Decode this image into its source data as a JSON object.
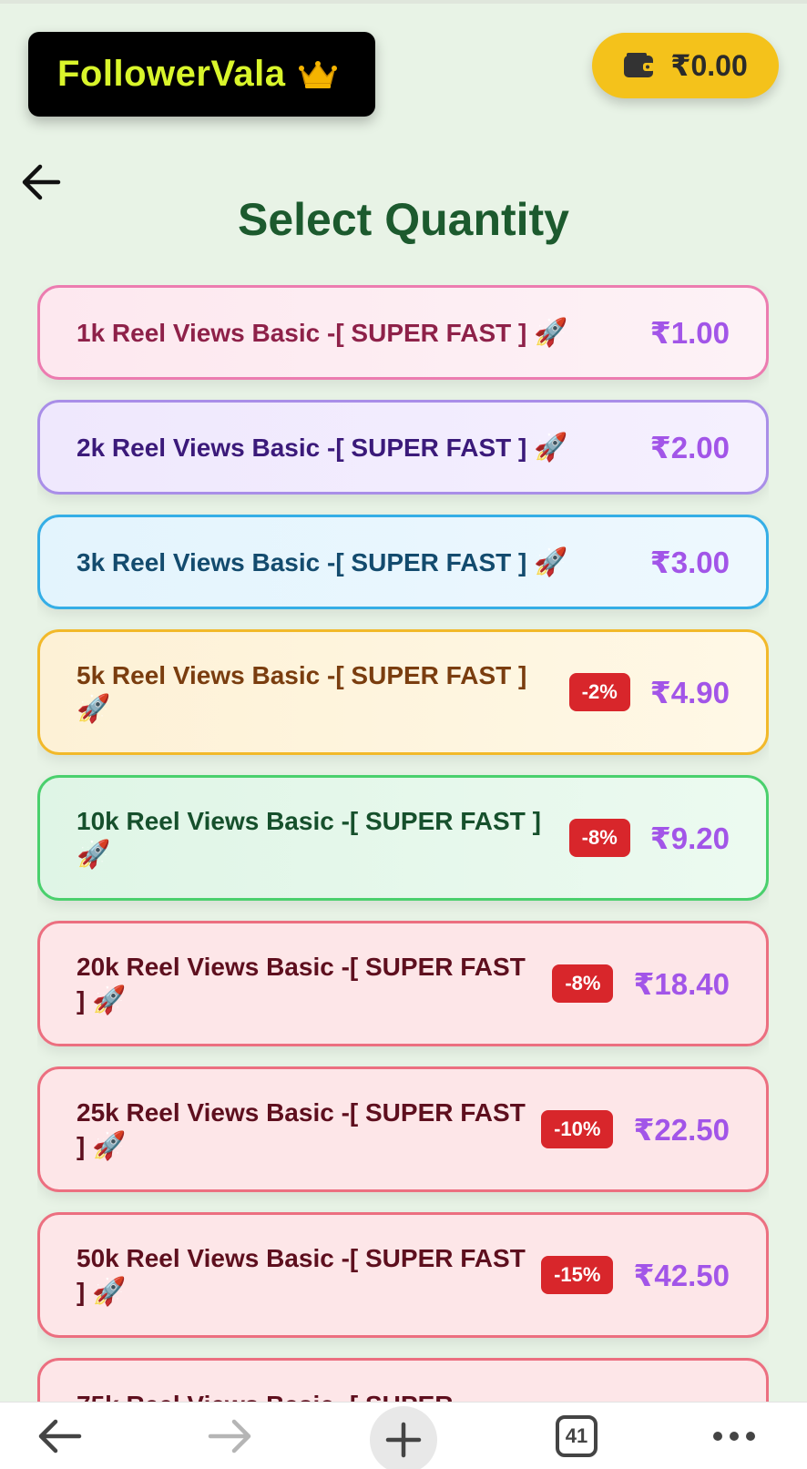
{
  "header": {
    "brand": "FollowerVala",
    "wallet_amount": "₹0.00"
  },
  "page": {
    "title": "Select Quantity"
  },
  "packages": [
    {
      "label": "1k Reel Views Basic -[ SUPER FAST ]",
      "badge": "",
      "price": "₹1.00"
    },
    {
      "label": "2k Reel Views Basic -[ SUPER FAST ]",
      "badge": "",
      "price": "₹2.00"
    },
    {
      "label": "3k Reel Views Basic -[ SUPER FAST ]",
      "badge": "",
      "price": "₹3.00"
    },
    {
      "label": "5k Reel Views Basic -[ SUPER FAST ]",
      "badge": "-2%",
      "price": "₹4.90"
    },
    {
      "label": "10k Reel Views Basic -[ SUPER FAST ]",
      "badge": "-8%",
      "price": "₹9.20"
    },
    {
      "label": "20k Reel Views Basic -[ SUPER FAST ]",
      "badge": "-8%",
      "price": "₹18.40"
    },
    {
      "label": "25k Reel Views Basic -[ SUPER FAST ]",
      "badge": "-10%",
      "price": "₹22.50"
    },
    {
      "label": "50k Reel Views Basic -[ SUPER FAST ]",
      "badge": "-15%",
      "price": "₹42.50"
    },
    {
      "label": "75k Reel Views Basic -[ SUPER",
      "badge": "",
      "price": ""
    }
  ],
  "colors": {
    "accent_green": "#1c5a2e",
    "price_purple": "#a255e8",
    "badge_red": "#d8262b",
    "wallet_yellow": "#f4c21b",
    "brand_lime": "#d9f52b"
  },
  "browser_nav": {
    "tab_count": "41",
    "icons": [
      "back-arrow-icon",
      "forward-arrow-icon",
      "plus-icon",
      "tabs-icon",
      "more-icon"
    ]
  }
}
